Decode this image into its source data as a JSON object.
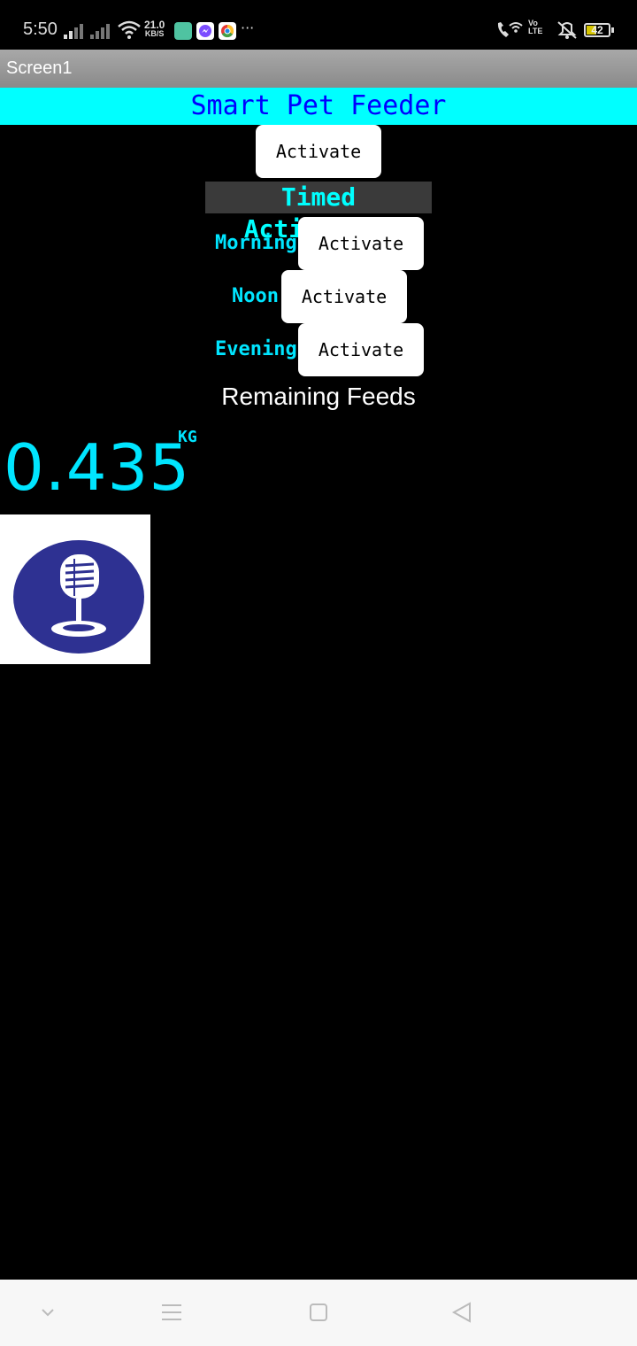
{
  "status_bar": {
    "time": "5:50",
    "speed_value": "21.0",
    "speed_unit": "KB/S",
    "volte_top": "Vo",
    "volte_bottom": "LTE",
    "battery": "42",
    "more": "···",
    "icons": [
      "signal-icon",
      "signal-icon",
      "wifi-icon",
      "app-icon",
      "messenger-icon",
      "chrome-icon",
      "wifi-calling-icon",
      "volte-icon",
      "mute-icon",
      "battery-icon"
    ]
  },
  "titlebar": {
    "title": "Screen1"
  },
  "header": {
    "title": "Smart Pet Feeder"
  },
  "main": {
    "activate_label": "Activate",
    "timed_title": "Timed Activation",
    "schedule": [
      {
        "label": "Morning",
        "button": "Activate"
      },
      {
        "label": "Noon",
        "button": "Activate"
      },
      {
        "label": "Evening",
        "button": "Activate"
      }
    ],
    "remaining_label": "Remaining Feeds",
    "remaining_value": "0.435",
    "remaining_unit": "KG",
    "voice_button_icon": "microphone-icon"
  },
  "navbar": {
    "icons": [
      "chevron-down-icon",
      "menu-icon",
      "home-square-icon",
      "back-triangle-icon"
    ]
  },
  "colors": {
    "header_bg": "#00ffff",
    "header_text": "#0000ff",
    "accent": "#00e5ff",
    "mic_circle": "#2e3192"
  }
}
